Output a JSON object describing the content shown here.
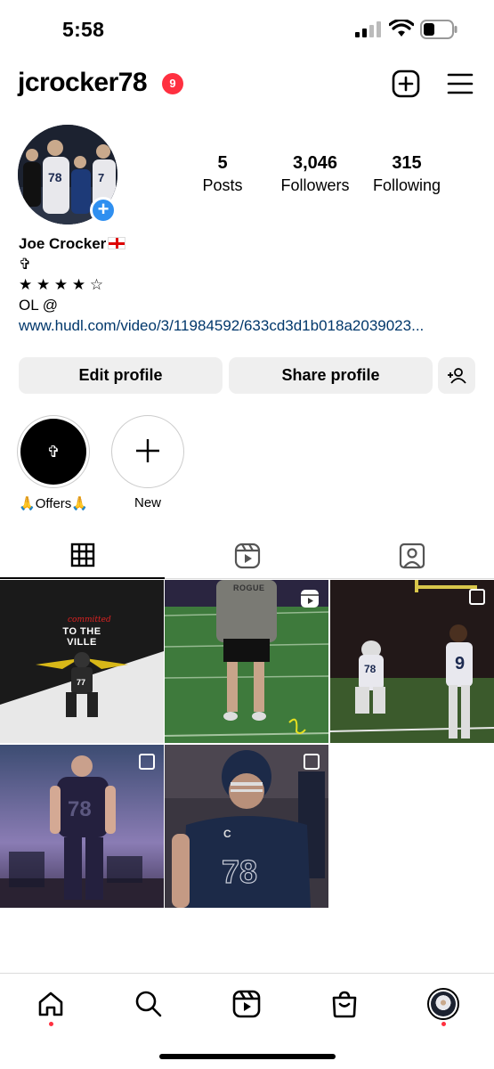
{
  "status_bar": {
    "time": "5:58"
  },
  "header": {
    "username": "jcrocker78",
    "notification_count": "9"
  },
  "profile": {
    "stats": [
      {
        "count": "5",
        "label": "Posts"
      },
      {
        "count": "3,046",
        "label": "Followers"
      },
      {
        "count": "315",
        "label": "Following"
      }
    ],
    "name": "Joe Crocker",
    "bio_lines": [
      "✞",
      "★ ★ ★ ★ ☆",
      "OL @"
    ],
    "link": "www.hudl.com/video/3/11984592/633cd3d1b018a2039023..."
  },
  "actions": {
    "edit_label": "Edit profile",
    "share_label": "Share profile"
  },
  "highlights": [
    {
      "label": "🙏Offers🙏",
      "cover_text": "✞"
    },
    {
      "label": "New"
    }
  ],
  "posts": [
    {
      "caption": "TO THE VILLE",
      "script_text": "committed",
      "jersey": "77",
      "badge": "none"
    },
    {
      "caption": "ROGUE",
      "badge": "reel"
    },
    {
      "jersey": "78",
      "jersey2": "9",
      "badge": "multi"
    },
    {
      "jersey": "78",
      "badge": "multi"
    },
    {
      "jersey": "78",
      "letter": "C",
      "badge": "multi"
    }
  ],
  "colors": {
    "accent_blue": "#2f8ff0",
    "badge_red": "#ff3040",
    "link_blue": "#00376b",
    "button_gray": "#efefef"
  }
}
